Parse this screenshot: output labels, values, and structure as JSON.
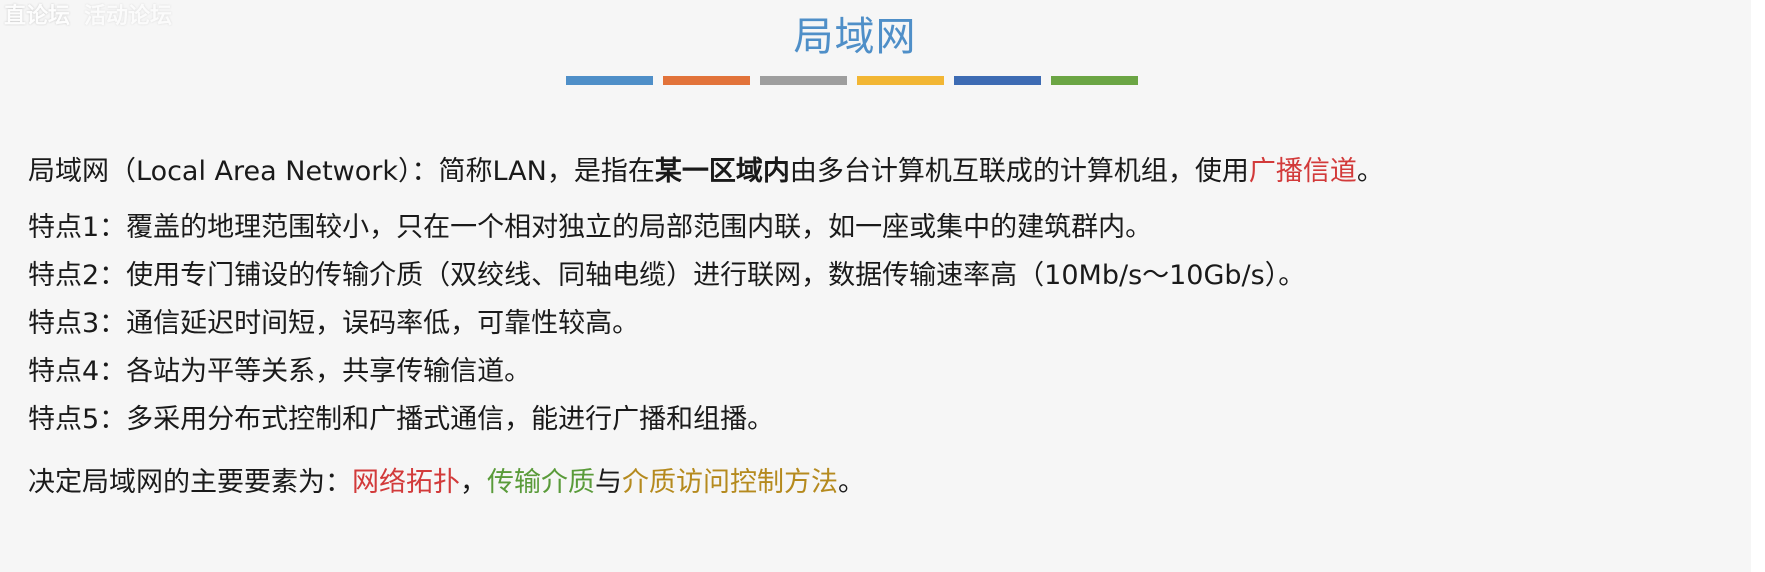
{
  "watermark": {
    "text1": "直论坛",
    "text2": "活动论坛"
  },
  "title": "局域网",
  "colors": {
    "title": "#4f8fc8",
    "bar1": "#4f8fc8",
    "bar2": "#e2733a",
    "bar3": "#9e9e9e",
    "bar4": "#f2b634",
    "bar5": "#3d6bb3",
    "bar6": "#6ba544",
    "highlight_red": "#d23a3a",
    "highlight_green": "#5a9b3a",
    "highlight_olive": "#b58a1e"
  },
  "definition": {
    "part1": "局域网（Local Area Network）：简称LAN，是指在",
    "bold": "某一区域内",
    "part2": "由多台计算机互联成的计算机组，使用",
    "red": "广播信道",
    "end": "。"
  },
  "features": [
    "特点1：覆盖的地理范围较小，只在一个相对独立的局部范围内联，如一座或集中的建筑群内。",
    "特点2：使用专门铺设的传输介质（双绞线、同轴电缆）进行联网，数据传输速率高（10Mb/s～10Gb/s）。",
    "特点3：通信延迟时间短，误码率低，可靠性较高。",
    "特点4：各站为平等关系，共享传输信道。",
    "特点5：多采用分布式控制和广播式通信，能进行广播和组播。"
  ],
  "conclusion": {
    "prefix": "决定局域网的主要要素为：",
    "item1": "网络拓扑",
    "sep1": "，",
    "item2": "传输介质",
    "sep2": "与",
    "item3": "介质访问控制方法",
    "end": "。"
  }
}
